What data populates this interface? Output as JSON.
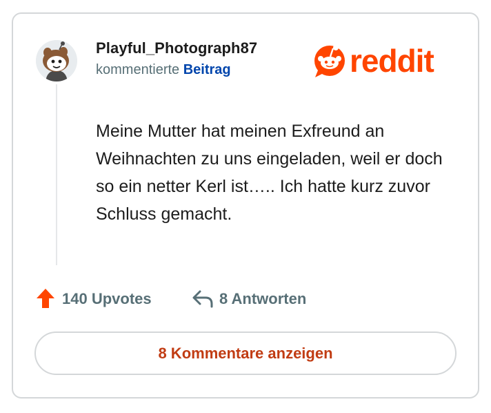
{
  "brand": {
    "name": "reddit",
    "color": "#ff4500"
  },
  "post": {
    "username": "Playful_Photograph87",
    "action": "kommentierte",
    "target_link": "Beitrag",
    "comment_text": "Meine Mutter hat meinen Exfreund an Weihnachten zu uns eingeladen, weil er doch so ein netter Kerl ist….. Ich hatte kurz zuvor Schluss gemacht."
  },
  "actions": {
    "upvotes_label": "140 Upvotes",
    "replies_label": "8 Antworten",
    "show_comments_label": "8 Kommentare anzeigen"
  },
  "icons": {
    "avatar": "snoo-avatar",
    "upvote": "upvote-arrow-icon",
    "reply": "reply-arrow-icon",
    "logo": "reddit-logo"
  },
  "colors": {
    "accent": "#ff4500",
    "link": "#0045ac",
    "muted": "#576f76",
    "button_text": "#c13c13",
    "border": "#d4d7d9"
  }
}
